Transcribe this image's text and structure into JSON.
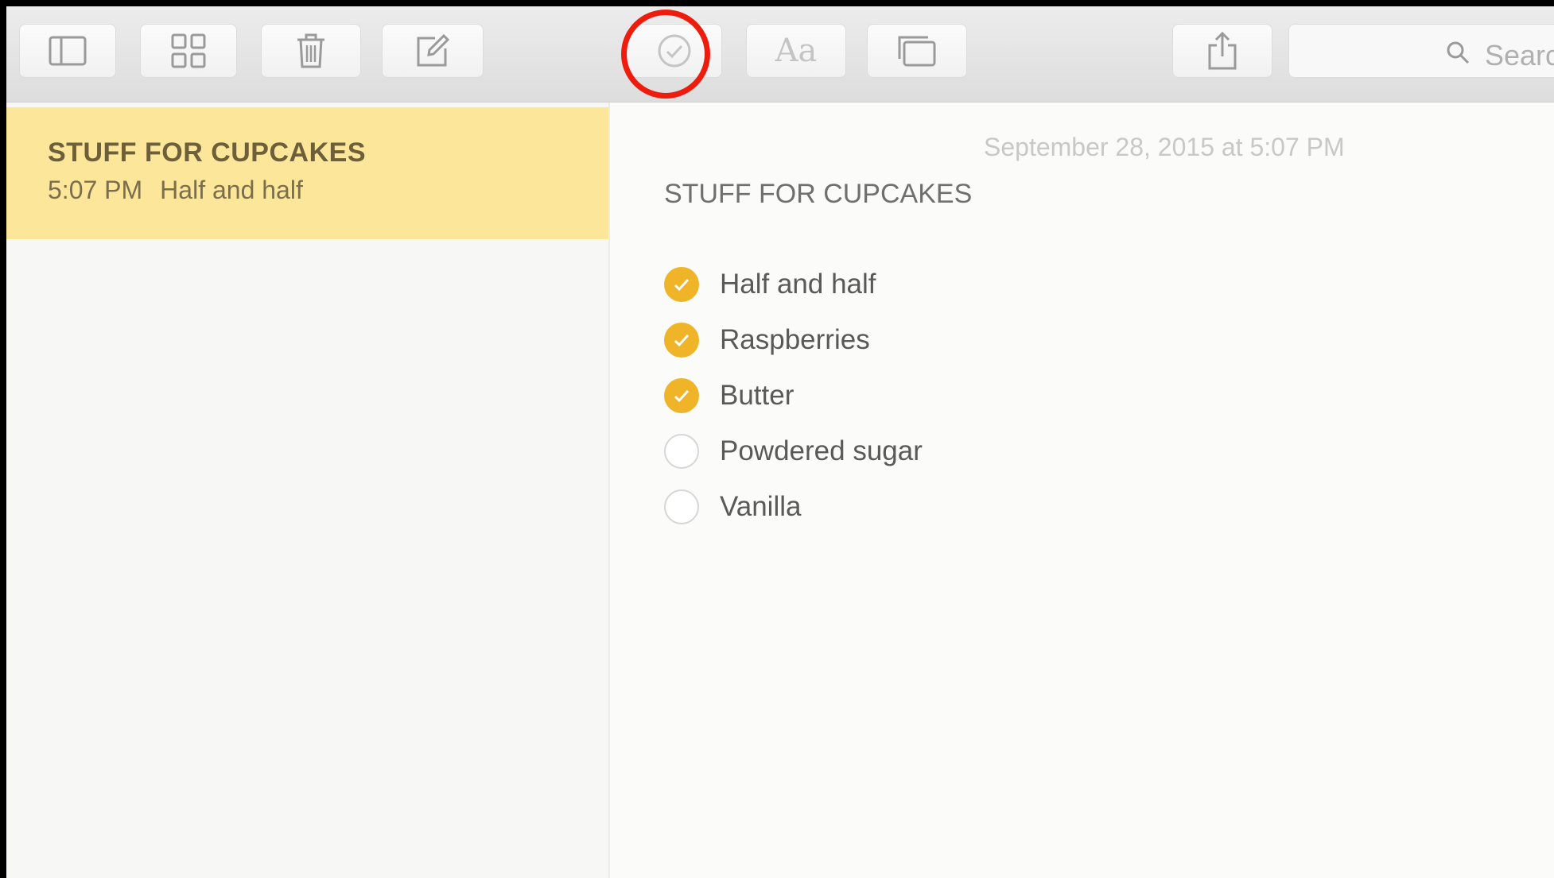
{
  "toolbar": {
    "buttons": [
      {
        "name": "toggle-sidebar-button",
        "icon": "sidebar-icon"
      },
      {
        "name": "attachments-browser-button",
        "icon": "grid-icon"
      },
      {
        "name": "delete-note-button",
        "icon": "trash-icon"
      },
      {
        "name": "new-note-button",
        "icon": "compose-icon"
      },
      {
        "name": "checklist-button",
        "icon": "checkmark-circle-icon"
      },
      {
        "name": "format-button",
        "icon": "text-format-icon"
      },
      {
        "name": "add-attachment-button",
        "icon": "photo-browser-icon"
      },
      {
        "name": "share-button",
        "icon": "share-icon"
      }
    ],
    "format_label": "Aa",
    "search": {
      "placeholder": "Search"
    }
  },
  "highlight_color": "#ee1c0c",
  "accent_color": "#f0b428",
  "selected_note_color": "#fbe699",
  "sidebar": {
    "notes": [
      {
        "title": "STUFF FOR CUPCAKES",
        "time": "5:07 PM",
        "preview": "Half and half",
        "selected": true
      }
    ]
  },
  "editor": {
    "date": "September 28, 2015 at 5:07 PM",
    "title": "STUFF FOR CUPCAKES",
    "checklist": [
      {
        "label": "Half and half",
        "checked": true
      },
      {
        "label": "Raspberries",
        "checked": true
      },
      {
        "label": "Butter",
        "checked": true
      },
      {
        "label": "Powdered sugar",
        "checked": false
      },
      {
        "label": "Vanilla",
        "checked": false
      }
    ]
  }
}
